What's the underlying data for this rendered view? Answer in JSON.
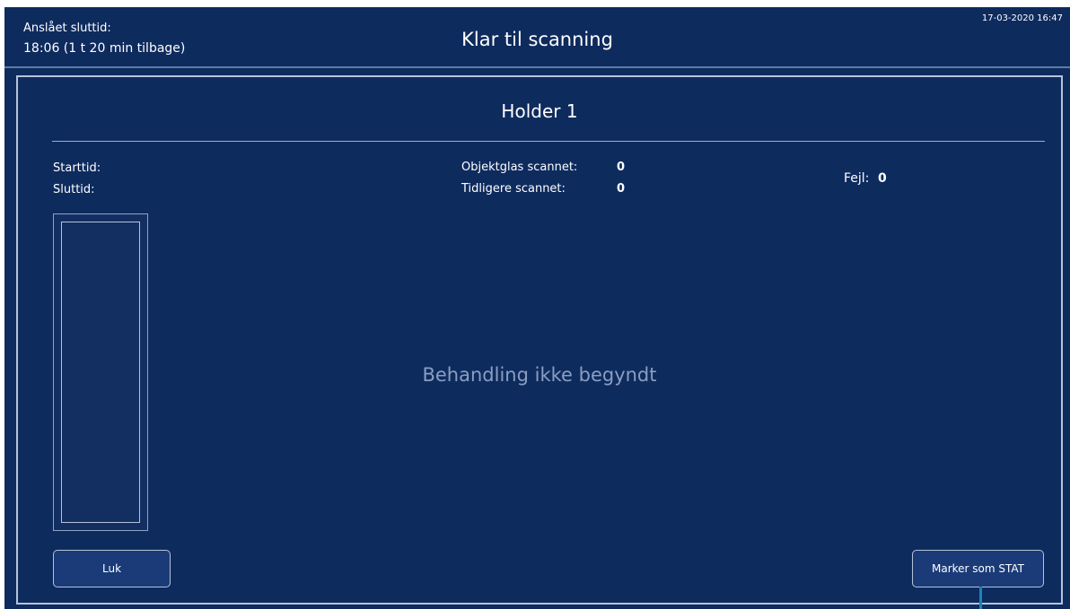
{
  "header": {
    "estimated_end_label": "Anslået sluttid:",
    "estimated_end_value": "18:06 (1 t 20 min tilbage)",
    "title": "Klar til scanning",
    "datetime": "17-03-2020 16:47"
  },
  "panel": {
    "title": "Holder 1",
    "start_label": "Starttid:",
    "end_label": "Sluttid:",
    "slides_scanned_label": "Objektglas scannet:",
    "slides_scanned_value": "0",
    "previously_scanned_label": "Tidligere scannet:",
    "previously_scanned_value": "0",
    "errors_label": "Fejl:",
    "errors_value": "0",
    "status_message": "Behandling ikke begyndt",
    "close_button": "Luk",
    "mark_stat_button": "Marker som STAT"
  }
}
